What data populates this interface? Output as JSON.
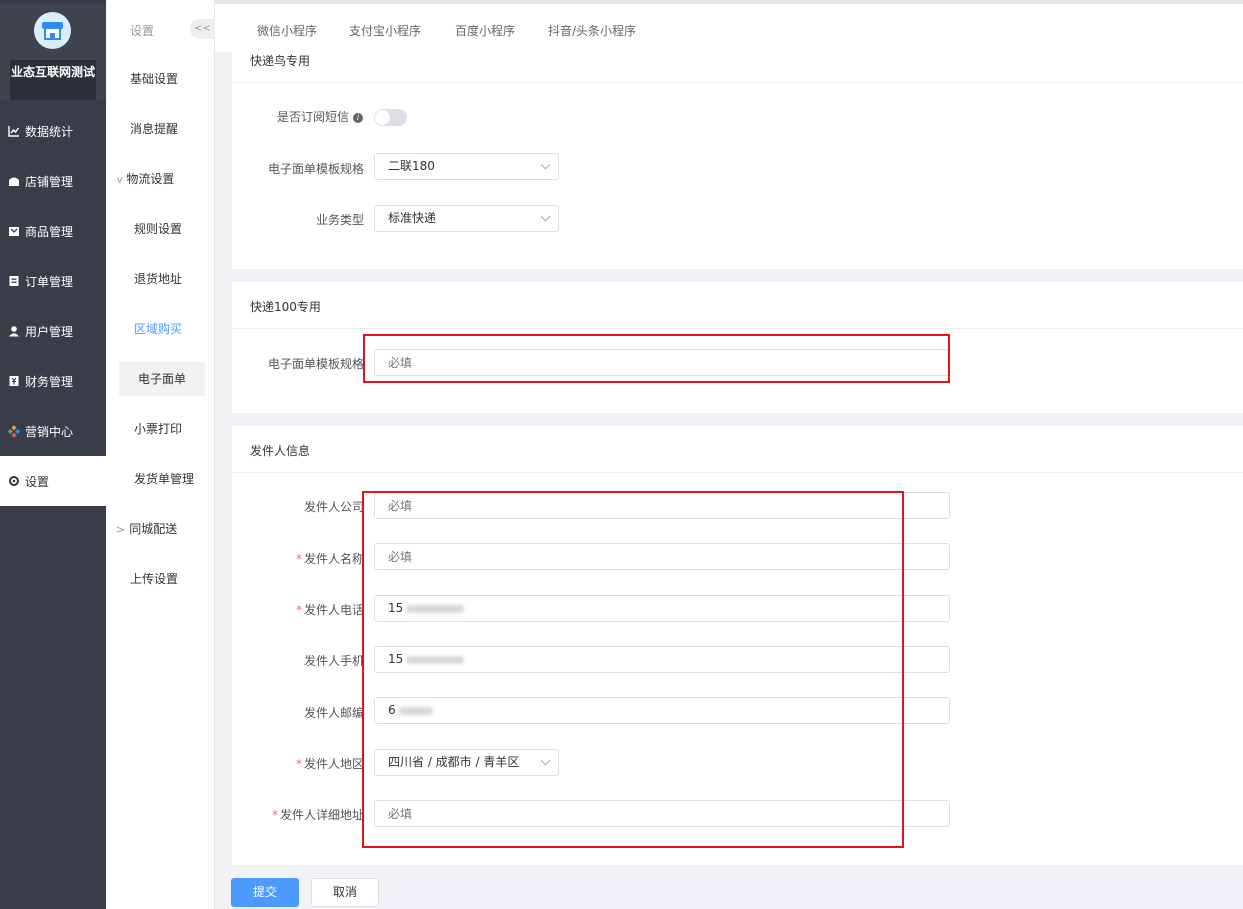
{
  "brand": {
    "name": "业态互联网测试"
  },
  "main_nav": [
    {
      "label": "数据统计",
      "icon": "chart-icon"
    },
    {
      "label": "店铺管理",
      "icon": "store-icon"
    },
    {
      "label": "商品管理",
      "icon": "goods-icon"
    },
    {
      "label": "订单管理",
      "icon": "order-icon"
    },
    {
      "label": "用户管理",
      "icon": "user-icon"
    },
    {
      "label": "财务管理",
      "icon": "finance-icon"
    },
    {
      "label": "营销中心",
      "icon": "marketing-icon"
    },
    {
      "label": "设置",
      "icon": "gear-icon",
      "active": true
    }
  ],
  "sub_nav": {
    "title": "设置",
    "collapse": "<<",
    "items": [
      {
        "label": "基础设置"
      },
      {
        "label": "消息提醒"
      },
      {
        "label": "物流设置",
        "prefix": "∨"
      },
      {
        "label": "规则设置"
      },
      {
        "label": "退货地址"
      },
      {
        "label": "区域购买"
      },
      {
        "label": "电子面单",
        "active": true
      },
      {
        "label": "小票打印"
      },
      {
        "label": "发货单管理"
      },
      {
        "label": "同城配送",
        "prefix": ">"
      },
      {
        "label": "上传设置"
      }
    ]
  },
  "top_tabs": [
    "微信小程序",
    "支付宝小程序",
    "百度小程序",
    "抖音/头条小程序"
  ],
  "kdn": {
    "title": "快递鸟专用",
    "sms_label": "是否订阅短信",
    "template_label": "电子面单模板规格",
    "template_value": "二联180",
    "biz_label": "业务类型",
    "biz_value": "标准快递"
  },
  "kd100": {
    "title": "快递100专用",
    "template_label": "电子面单模板规格",
    "template_placeholder": "必填"
  },
  "sender": {
    "title": "发件人信息",
    "company_label": "发件人公司",
    "company_placeholder": "必填",
    "name_label": "发件人名称",
    "name_placeholder": "必填",
    "phone_label": "发件人电话",
    "phone_prefix": "15",
    "mobile_label": "发件人手机",
    "mobile_prefix": "15",
    "zip_label": "发件人邮编",
    "zip_prefix": "6",
    "region_label": "发件人地区",
    "region_value": "四川省 / 成都市 / 青羊区",
    "address_label": "发件人详细地址",
    "address_placeholder": "必填",
    "required_mark": "*"
  },
  "actions": {
    "submit": "提交",
    "cancel": "取消"
  },
  "colors": {
    "sidebar": "#393d49",
    "primary": "#4b9bff",
    "highlight": "#e0141e"
  }
}
